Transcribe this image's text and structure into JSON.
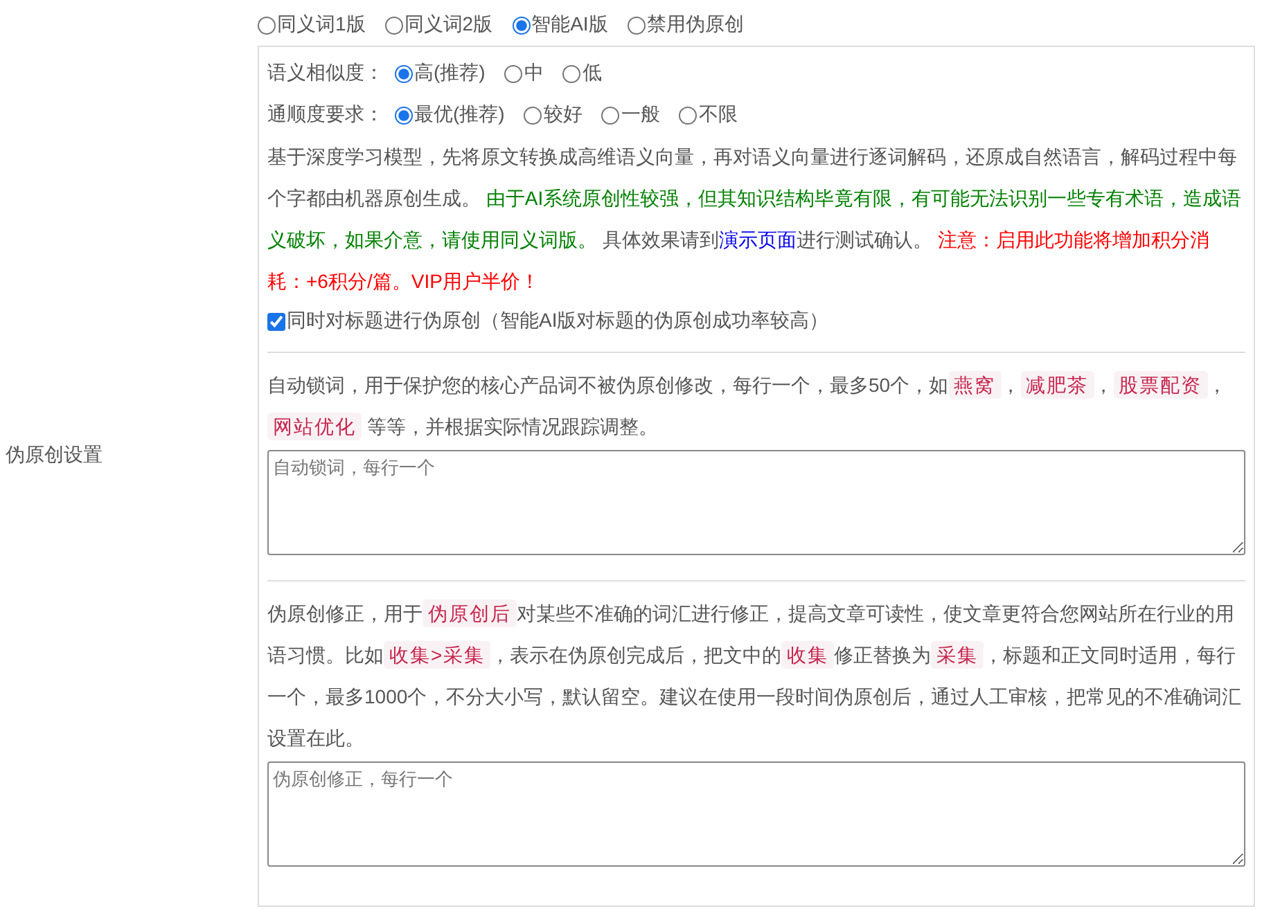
{
  "section_label": "伪原创设置",
  "mode_options": [
    {
      "label": "同义词1版",
      "selected": false
    },
    {
      "label": "同义词2版",
      "selected": false
    },
    {
      "label": "智能AI版",
      "selected": true
    },
    {
      "label": "禁用伪原创",
      "selected": false
    }
  ],
  "similarity": {
    "label": "语义相似度：",
    "options": [
      {
        "label": "高(推荐)",
        "selected": true
      },
      {
        "label": "中",
        "selected": false
      },
      {
        "label": "低",
        "selected": false
      }
    ]
  },
  "fluency": {
    "label": "通顺度要求：",
    "options": [
      {
        "label": "最优(推荐)",
        "selected": true
      },
      {
        "label": "较好",
        "selected": false
      },
      {
        "label": "一般",
        "selected": false
      },
      {
        "label": "不限",
        "selected": false
      }
    ]
  },
  "ai_description": [
    {
      "kind": "plain",
      "text": "基于深度学习模型，先将原文转换成高维语义向量，再对语义向量进行逐词解码，还原成自然语言，解码过程中每个字都由机器原创生成。 "
    },
    {
      "kind": "notice",
      "text": "由于AI系统原创性较强，但其知识结构毕竟有限，有可能无法识别一些专有术语，造成语义破坏，如果介意，请使用同义词版。"
    },
    {
      "kind": "plain",
      "text": " 具体效果请到"
    },
    {
      "kind": "link",
      "text": "演示页面"
    },
    {
      "kind": "plain",
      "text": "进行测试确认。 "
    },
    {
      "kind": "warning",
      "text": "注意：启用此功能将增加积分消耗：+6积分/篇。VIP用户半价！"
    }
  ],
  "title_checkbox": {
    "label": "同时对标题进行伪原创（智能AI版对标题的伪原创成功率较高）",
    "checked": true
  },
  "lock_words": {
    "description": [
      {
        "kind": "plain",
        "text": "自动锁词，用于保护您的核心产品词不被伪原创修改，每行一个，最多50个，如"
      },
      {
        "kind": "code",
        "text": "燕窝"
      },
      {
        "kind": "plain",
        "text": "，"
      },
      {
        "kind": "code",
        "text": "减肥茶"
      },
      {
        "kind": "plain",
        "text": "，"
      },
      {
        "kind": "code",
        "text": "股票配资"
      },
      {
        "kind": "plain",
        "text": "，"
      },
      {
        "kind": "code",
        "text": "网站优化"
      },
      {
        "kind": "plain",
        "text": " 等等，并根据实际情况跟踪调整。"
      }
    ],
    "placeholder": "自动锁词，每行一个"
  },
  "correction": {
    "description": [
      {
        "kind": "plain",
        "text": "伪原创修正，用于"
      },
      {
        "kind": "code",
        "text": "伪原创后"
      },
      {
        "kind": "plain",
        "text": "对某些不准确的词汇进行修正，提高文章可读性，使文章更符合您网站所在行业的用语习惯。比如"
      },
      {
        "kind": "code",
        "text": "收集>采集"
      },
      {
        "kind": "plain",
        "text": "，表示在伪原创完成后，把文中的"
      },
      {
        "kind": "code",
        "text": "收集"
      },
      {
        "kind": "plain",
        "text": "修正替换为"
      },
      {
        "kind": "code",
        "text": "采集"
      },
      {
        "kind": "plain",
        "text": "，标题和正文同时适用，每行一个，最多1000个，不分大小写，默认留空。建议在使用一段时间伪原创后，通过人工审核，把常见的不准确词汇设置在此。"
      }
    ],
    "placeholder": "伪原创修正，每行一个"
  }
}
